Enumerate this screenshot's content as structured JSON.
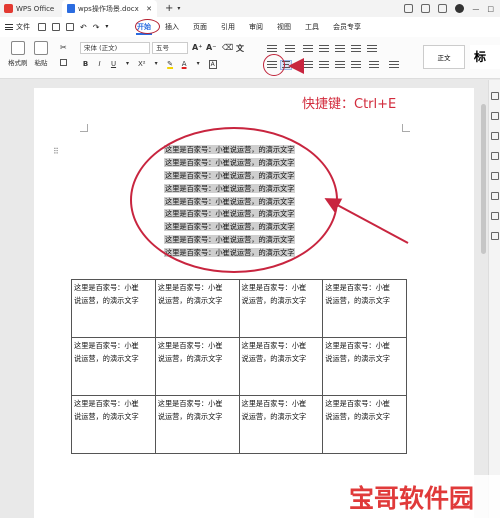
{
  "titlebar": {
    "app_name": "WPS Office",
    "tab_name": "wps操作场景.docx"
  },
  "menubar": {
    "file_label": "文件",
    "tabs": [
      "开始",
      "插入",
      "页面",
      "引用",
      "审阅",
      "视图",
      "工具",
      "会员专享"
    ],
    "active_tab": "开始"
  },
  "ribbon": {
    "format_painter": "格式刷",
    "paste": "粘贴",
    "font_name": "宋体 (正文)",
    "font_size": "五号",
    "bold": "B",
    "italic": "I",
    "underline": "U",
    "superscript": "X²",
    "font_color": "A",
    "style_normal": "正文",
    "style_heading": "标"
  },
  "annotation": {
    "shortcut": "快捷键：Ctrl+E",
    "accent_color": "#c8253f"
  },
  "document": {
    "lines": [
      "这里是百家号：小崔说运营，的演示文字",
      "这里是百家号：小崔说运营，的演示文字",
      "这里是百家号：小崔说运营，的演示文字",
      "这里是百家号：小崔说运营，的演示文字",
      "这里是百家号：小崔说运营，的演示文字",
      "这里是百家号：小崔说运营，的演示文字",
      "这里是百家号：小崔说运营，的演示文字",
      "这里是百家号：小崔说运营，的演示文字",
      "这里是百家号：小崔说运营，的演示文字"
    ],
    "table_cell_line1": "这里是百家号：小崔",
    "table_cell_line2": "说运营，的演示文字"
  },
  "watermark": {
    "text": "宝哥软件园",
    "box_text": ""
  }
}
